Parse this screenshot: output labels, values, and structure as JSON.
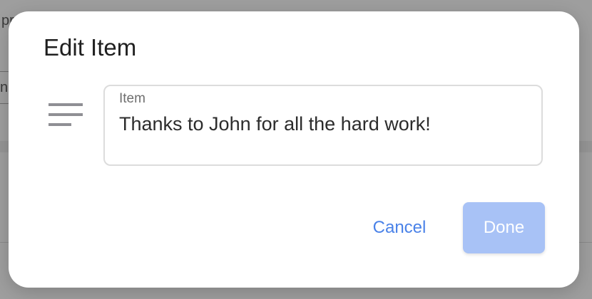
{
  "background": {
    "partial_text": "pr",
    "partial_field_text": "n"
  },
  "dialog": {
    "title": "Edit Item",
    "field": {
      "label": "Item",
      "value": "Thanks to John for all the hard work!",
      "icon": "notes-icon"
    },
    "cancel_label": "Cancel",
    "done_label": "Done",
    "done_enabled": false
  },
  "colors": {
    "accent": "#4a82e8",
    "done_disabled_bg": "#a8c2f6",
    "overlay": "#9e9e9e",
    "icon_gray": "#8f8f94"
  }
}
